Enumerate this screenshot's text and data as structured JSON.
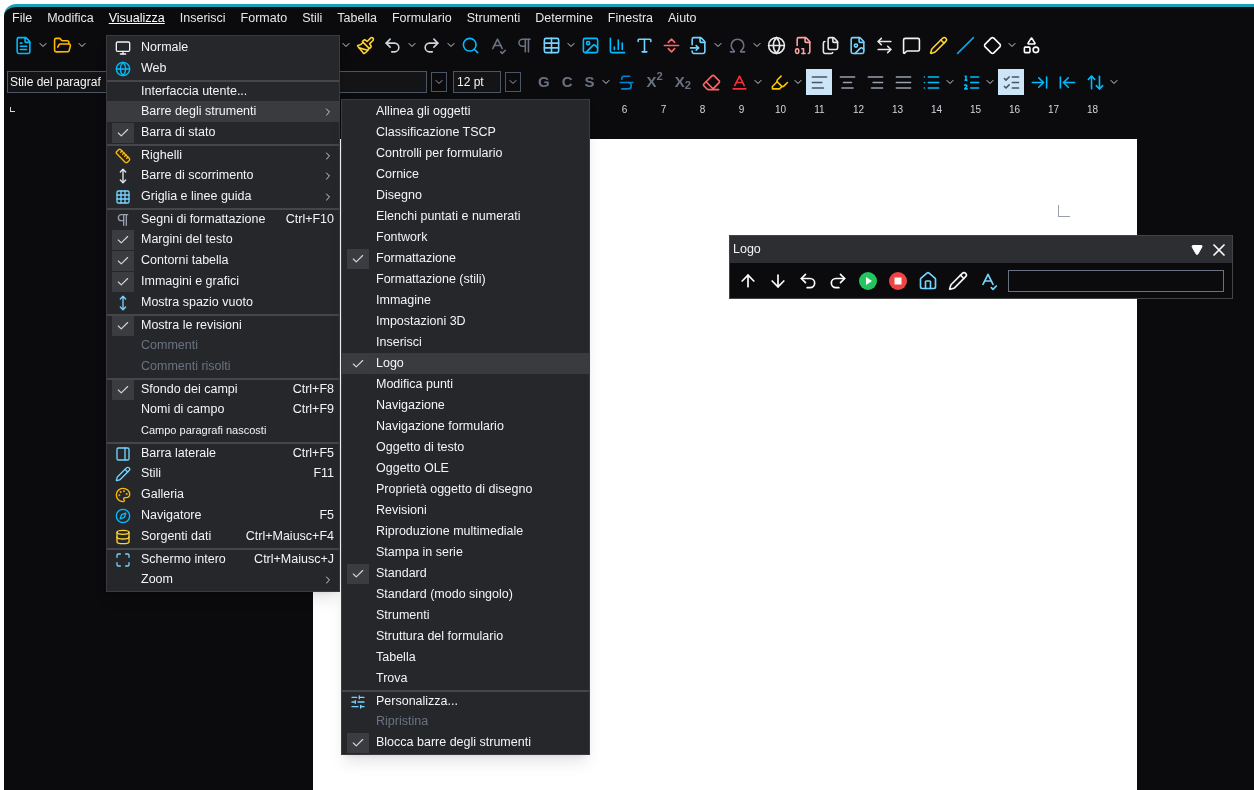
{
  "menu_bar": [
    {
      "label": "File",
      "selected": false
    },
    {
      "label": "Modifica",
      "selected": false
    },
    {
      "label": "Visualizza",
      "selected": true
    },
    {
      "label": "Inserisci",
      "selected": false
    },
    {
      "label": "Formato",
      "selected": false
    },
    {
      "label": "Stili",
      "selected": false
    },
    {
      "label": "Tabella",
      "selected": false
    },
    {
      "label": "Formulario",
      "selected": false
    },
    {
      "label": "Strumenti",
      "selected": false
    },
    {
      "label": "Determine",
      "selected": false
    },
    {
      "label": "Finestra",
      "selected": false
    },
    {
      "label": "Aiuto",
      "selected": false
    }
  ],
  "format_toolbar": {
    "paragraph_style": "Stile del paragraf",
    "font_size": "12 pt",
    "buttons": [
      {
        "kind": "text",
        "label": "G",
        "selected": false
      },
      {
        "kind": "text",
        "label": "C",
        "selected": false
      },
      {
        "kind": "text",
        "label": "S",
        "selected": false
      },
      {
        "kind": "strike",
        "selected": false
      },
      {
        "kind": "text",
        "label": "X$^{2}$",
        "selected": false
      },
      {
        "kind": "text",
        "label": "X$_{2}$",
        "selected": false
      },
      {
        "kind": "eraser",
        "selected": false
      },
      {
        "kind": "font-color",
        "selected": false
      },
      {
        "kind": "highlight",
        "selected": false
      },
      {
        "kind": "align-left",
        "selected": true
      },
      {
        "kind": "align-center",
        "selected": false
      },
      {
        "kind": "align-right",
        "selected": false
      },
      {
        "kind": "justify",
        "selected": false
      },
      {
        "kind": "bullets",
        "selected": false
      },
      {
        "kind": "numbering",
        "selected": false
      },
      {
        "kind": "outline",
        "selected": true
      },
      {
        "kind": "indent",
        "selected": false
      },
      {
        "kind": "outdent",
        "selected": false
      },
      {
        "kind": "spacing",
        "selected": false
      }
    ]
  },
  "ruler": {
    "numbers": [
      "6",
      "7",
      "8",
      "9",
      "10",
      "11",
      "12",
      "13",
      "14",
      "15",
      "16",
      "17",
      "18"
    ]
  },
  "view_menu": [
    {
      "kind": "icon",
      "label": "Normale",
      "selected": false
    },
    {
      "kind": "icon",
      "label": "Web",
      "selected": false
    },
    {
      "kind": "plain",
      "label": "Interfaccia utente...",
      "separator_before": true,
      "selected": false
    },
    {
      "kind": "plain",
      "label": "Barre degli strumenti",
      "submenu": true,
      "selected": true
    },
    {
      "kind": "check",
      "label": "Barra di stato",
      "checked": true,
      "selected": false
    },
    {
      "kind": "icon",
      "label": "Righelli",
      "submenu": true,
      "separator_before": true,
      "selected": false
    },
    {
      "kind": "icon",
      "label": "Barre di scorrimento",
      "submenu": true,
      "selected": false
    },
    {
      "kind": "icon",
      "label": "Griglia e linee guida",
      "submenu": true,
      "selected": false
    },
    {
      "kind": "icon",
      "label": "Segni di formattazione",
      "shortcut": "Ctrl+F10",
      "separator_before": true,
      "selected": false
    },
    {
      "kind": "check",
      "label": "Margini del testo",
      "checked": true,
      "selected": false
    },
    {
      "kind": "check",
      "label": "Contorni tabella",
      "checked": true,
      "selected": false
    },
    {
      "kind": "check",
      "label": "Immagini e grafici",
      "checked": true,
      "selected": false
    },
    {
      "kind": "icon",
      "label": "Mostra spazio vuoto",
      "selected": false
    },
    {
      "kind": "check",
      "label": "Mostra le revisioni",
      "checked": true,
      "separator_before": true,
      "selected": false
    },
    {
      "kind": "check",
      "label": "Commenti",
      "checked": false,
      "disabled": true,
      "selected": false
    },
    {
      "kind": "check",
      "label": "Commenti risolti",
      "checked": false,
      "disabled": true,
      "selected": false
    },
    {
      "kind": "check",
      "label": "Sfondo dei campi",
      "shortcut": "Ctrl+F8",
      "checked": true,
      "separator_before": true,
      "selected": false
    },
    {
      "kind": "check",
      "label": "Nomi di campo",
      "shortcut": "Ctrl+F9",
      "checked": false,
      "selected": false
    },
    {
      "kind": "check",
      "label": "Campo paragrafi nascosti",
      "checked": false,
      "selected": false
    },
    {
      "kind": "icon",
      "label": "Barra laterale",
      "shortcut": "Ctrl+F5",
      "separator_before": true,
      "selected": false
    },
    {
      "kind": "icon",
      "label": "Stili",
      "shortcut": "F11",
      "selected": false
    },
    {
      "kind": "icon",
      "label": "Galleria",
      "selected": false
    },
    {
      "kind": "icon",
      "label": "Navigatore",
      "shortcut": "F5",
      "selected": false
    },
    {
      "kind": "icon",
      "label": "Sorgenti dati",
      "shortcut": "Ctrl+Maiusc+F4",
      "selected": false
    },
    {
      "kind": "icon",
      "label": "Schermo intero",
      "shortcut": "Ctrl+Maiusc+J",
      "separator_before": true,
      "selected": false
    },
    {
      "kind": "plain",
      "label": "Zoom",
      "submenu": true,
      "selected": false
    }
  ],
  "toolbars_submenu": [
    {
      "kind": "check",
      "label": "Allinea gli oggetti",
      "checked": false,
      "selected": false
    },
    {
      "kind": "check",
      "label": "Classificazione TSCP",
      "checked": false,
      "selected": false
    },
    {
      "kind": "check",
      "label": "Controlli per formulario",
      "checked": false,
      "selected": false
    },
    {
      "kind": "check",
      "label": "Cornice",
      "checked": false,
      "selected": false
    },
    {
      "kind": "check",
      "label": "Disegno",
      "checked": false,
      "selected": false
    },
    {
      "kind": "check",
      "label": "Elenchi puntati e numerati",
      "checked": false,
      "selected": false
    },
    {
      "kind": "check",
      "label": "Fontwork",
      "checked": false,
      "selected": false
    },
    {
      "kind": "check",
      "label": "Formattazione",
      "checked": true,
      "selected": false
    },
    {
      "kind": "check",
      "label": "Formattazione (stili)",
      "checked": false,
      "selected": false
    },
    {
      "kind": "check",
      "label": "Immagine",
      "checked": false,
      "selected": false
    },
    {
      "kind": "check",
      "label": "Impostazioni 3D",
      "checked": false,
      "selected": false
    },
    {
      "kind": "check",
      "label": "Inserisci",
      "checked": false,
      "selected": false
    },
    {
      "kind": "check",
      "label": "Logo",
      "checked": true,
      "selected": true
    },
    {
      "kind": "check",
      "label": "Modifica punti",
      "checked": false,
      "selected": false
    },
    {
      "kind": "check",
      "label": "Navigazione",
      "checked": false,
      "selected": false
    },
    {
      "kind": "check",
      "label": "Navigazione formulario",
      "checked": false,
      "selected": false
    },
    {
      "kind": "check",
      "label": "Oggetto di testo",
      "checked": false,
      "selected": false
    },
    {
      "kind": "check",
      "label": "Oggetto OLE",
      "checked": false,
      "selected": false
    },
    {
      "kind": "check",
      "label": "Proprietà oggetto di disegno",
      "checked": false,
      "selected": false
    },
    {
      "kind": "check",
      "label": "Revisioni",
      "checked": false,
      "selected": false
    },
    {
      "kind": "check",
      "label": "Riproduzione multimediale",
      "checked": false,
      "selected": false
    },
    {
      "kind": "check",
      "label": "Stampa in serie",
      "checked": false,
      "selected": false
    },
    {
      "kind": "check",
      "label": "Standard",
      "checked": true,
      "selected": false
    },
    {
      "kind": "check",
      "label": "Standard (modo singolo)",
      "checked": false,
      "selected": false
    },
    {
      "kind": "check",
      "label": "Strumenti",
      "checked": false,
      "selected": false
    },
    {
      "kind": "check",
      "label": "Struttura del formulario",
      "checked": false,
      "selected": false
    },
    {
      "kind": "check",
      "label": "Tabella",
      "checked": false,
      "selected": false
    },
    {
      "kind": "check",
      "label": "Trova",
      "checked": false,
      "selected": false
    },
    {
      "kind": "icon",
      "label": "Personalizza...",
      "separator_before": true,
      "selected": false
    },
    {
      "kind": "check",
      "label": "Ripristina",
      "checked": false,
      "disabled": true,
      "selected": false
    },
    {
      "kind": "check",
      "label": "Blocca barre degli strumenti",
      "checked": true,
      "selected": false
    }
  ],
  "logo_toolbar": {
    "title": "Logo"
  }
}
